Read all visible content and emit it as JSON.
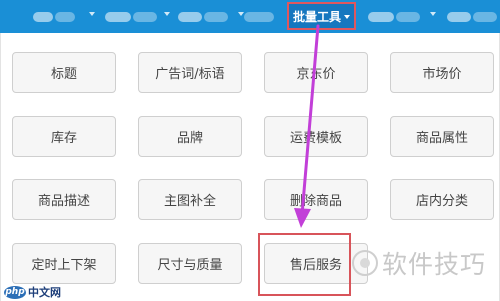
{
  "nav": {
    "active_label": "批量工具"
  },
  "buttons": [
    {
      "label": "标题"
    },
    {
      "label": "广告词/标语"
    },
    {
      "label": "京东价"
    },
    {
      "label": "市场价"
    },
    {
      "label": "库存"
    },
    {
      "label": "品牌"
    },
    {
      "label": "运费模板"
    },
    {
      "label": "商品属性"
    },
    {
      "label": "商品描述"
    },
    {
      "label": "主图补全"
    },
    {
      "label": "删除商品"
    },
    {
      "label": "店内分类"
    },
    {
      "label": "定时上下架"
    },
    {
      "label": "尺寸与质量"
    },
    {
      "label": "售后服务"
    }
  ],
  "watermarks": {
    "left_logo": "php",
    "left_text": "中文网",
    "right_text": "软件技巧"
  },
  "colors": {
    "topbar": "#1a8fd6",
    "highlight": "#d8545a",
    "arrow": "#c23fd8"
  }
}
